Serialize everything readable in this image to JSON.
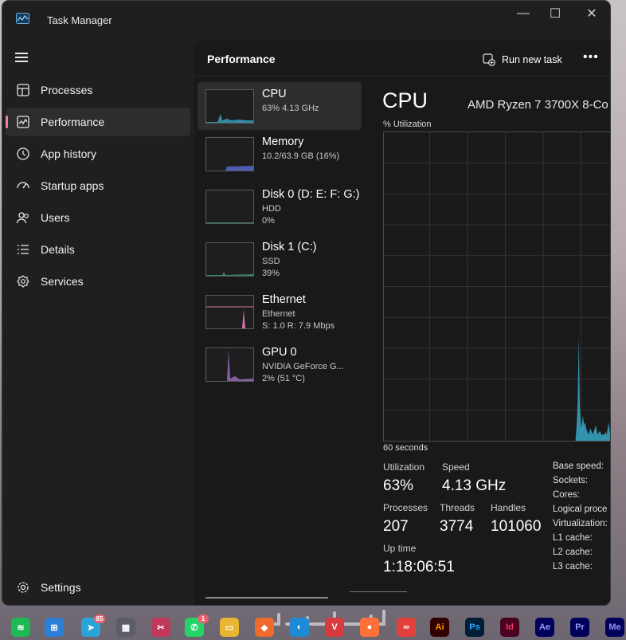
{
  "window": {
    "title": "Task Manager",
    "caption": {
      "minimize": "—",
      "maximize": "☐",
      "close": "✕"
    }
  },
  "sidebar": {
    "items": [
      {
        "label": "Processes",
        "icon": "processes-icon"
      },
      {
        "label": "Performance",
        "icon": "performance-icon",
        "active": true
      },
      {
        "label": "App history",
        "icon": "history-icon"
      },
      {
        "label": "Startup apps",
        "icon": "startup-icon"
      },
      {
        "label": "Users",
        "icon": "users-icon"
      },
      {
        "label": "Details",
        "icon": "details-icon"
      },
      {
        "label": "Services",
        "icon": "services-icon"
      }
    ],
    "settings_label": "Settings"
  },
  "header": {
    "title": "Performance",
    "run_task_label": "Run new task",
    "more_label": "•••"
  },
  "tiles": [
    {
      "name": "CPU",
      "line1": "63% 4.13 GHz",
      "line2": "",
      "color": "#37a8c9"
    },
    {
      "name": "Memory",
      "line1": "10.2/63.9 GB (16%)",
      "line2": "",
      "color": "#5a6bd6"
    },
    {
      "name": "Disk 0 (D: E: F: G:)",
      "line1": "HDD",
      "line2": "0%",
      "color": "#3f9d77"
    },
    {
      "name": "Disk 1 (C:)",
      "line1": "SSD",
      "line2": "39%",
      "color": "#3f9d77"
    },
    {
      "name": "Ethernet",
      "line1": "Ethernet",
      "line2": "S: 1.0 R: 7.9 Mbps",
      "color": "#d774a6"
    },
    {
      "name": "GPU 0",
      "line1": "NVIDIA GeForce G...",
      "line2": "2% (51 °C)",
      "color": "#9f6fc7"
    }
  ],
  "cpu": {
    "title": "CPU",
    "model": "AMD Ryzen 7 3700X 8-Co",
    "util_label": "% Utilization",
    "time_label": "60 seconds",
    "utilization_label": "Utilization",
    "utilization": "63%",
    "speed_label": "Speed",
    "speed": "4.13 GHz",
    "processes_label": "Processes",
    "processes": "207",
    "threads_label": "Threads",
    "threads": "3774",
    "handles_label": "Handles",
    "handles": "101060",
    "uptime_label": "Up time",
    "uptime": "1:18:06:51",
    "specs": [
      "Base speed:",
      "Sockets:",
      "Cores:",
      "Logical proce",
      "Virtualization:",
      "L1 cache:",
      "L2 cache:",
      "L3 cache:"
    ],
    "graph_color": "#37a8c9",
    "graph_values_pct": [
      0,
      0,
      0,
      0,
      0,
      0,
      0,
      0,
      0,
      0,
      0,
      0,
      0,
      0,
      0,
      0,
      0,
      0,
      0,
      0,
      0,
      0,
      0,
      0,
      0,
      0,
      0,
      0,
      0,
      0,
      0,
      0,
      0,
      0,
      0,
      0,
      0,
      0,
      0,
      0,
      0,
      0,
      0,
      0,
      0,
      0,
      0,
      0,
      0,
      0,
      0,
      0,
      0,
      0,
      0,
      0,
      0,
      0,
      0,
      0,
      0,
      0,
      0,
      0,
      0,
      0,
      0,
      0,
      0,
      0,
      0,
      0,
      0,
      0,
      0,
      0,
      0,
      0,
      0,
      0,
      0,
      0,
      0,
      0,
      0,
      0,
      0,
      0,
      0,
      0,
      0,
      0,
      0,
      0,
      0,
      0,
      0,
      0,
      0,
      0,
      0,
      0,
      0,
      0,
      0,
      0,
      0,
      0,
      0,
      0,
      0,
      0,
      0,
      0,
      0,
      0,
      0,
      0,
      0,
      0,
      0,
      0,
      0,
      0,
      0,
      0,
      0,
      0,
      0,
      0,
      0,
      0,
      0,
      0,
      0,
      0,
      0,
      0,
      0,
      0,
      0,
      0,
      0,
      0,
      0,
      0,
      0,
      0,
      0,
      0,
      0,
      0,
      0,
      0,
      0,
      0,
      0,
      0,
      0,
      0,
      0,
      0,
      0,
      0,
      0,
      0,
      0,
      0,
      0,
      0,
      0,
      0,
      0,
      0,
      0,
      0,
      0,
      0,
      0,
      0,
      5,
      12,
      34,
      12,
      4,
      6,
      8,
      5,
      6,
      4,
      3,
      2,
      3,
      4,
      3,
      2,
      3,
      4,
      5,
      3,
      2,
      3,
      3,
      2,
      2,
      2,
      2,
      3,
      2,
      4,
      6,
      3,
      2
    ]
  },
  "taskbar": {
    "icons": [
      {
        "name": "spotify-icon",
        "glyph": "≋",
        "color": "#1db954"
      },
      {
        "name": "store-icon",
        "glyph": "⊞",
        "color": "#2c7fd6"
      },
      {
        "name": "telegram-icon",
        "glyph": "➤",
        "color": "#2aa3d8",
        "badge": "85"
      },
      {
        "name": "calculator-icon",
        "glyph": "▦",
        "color": "#5d5d6a"
      },
      {
        "name": "snipping-tool-icon",
        "glyph": "✂",
        "color": "#c0395a"
      },
      {
        "name": "whatsapp-icon",
        "glyph": "✆",
        "color": "#25d366",
        "badge": "1"
      },
      {
        "name": "file-explorer-icon",
        "glyph": "▭",
        "color": "#e9b634"
      },
      {
        "name": "brave-icon",
        "glyph": "◆",
        "color": "#f06a2c"
      },
      {
        "name": "edge-icon",
        "glyph": "◐",
        "color": "#1e8ad6"
      },
      {
        "name": "vivaldi-icon",
        "glyph": "V",
        "color": "#d73b3e"
      },
      {
        "name": "firefox-icon",
        "glyph": "●",
        "color": "#ff7139"
      },
      {
        "name": "creative-cloud-icon",
        "glyph": "∞",
        "color": "#e2403a"
      },
      {
        "name": "illustrator-icon",
        "glyph": "Ai",
        "color": "#330000",
        "text_color": "#ff9a00"
      },
      {
        "name": "photoshop-icon",
        "glyph": "Ps",
        "color": "#001e36",
        "text_color": "#31a8ff"
      },
      {
        "name": "indesign-icon",
        "glyph": "Id",
        "color": "#49021f",
        "text_color": "#ff3366"
      },
      {
        "name": "after-effects-icon",
        "glyph": "Ae",
        "color": "#00005b",
        "text_color": "#9999ff"
      },
      {
        "name": "premiere-icon",
        "glyph": "Pr",
        "color": "#00005b",
        "text_color": "#9999ff"
      },
      {
        "name": "media-encoder-icon",
        "glyph": "Me",
        "color": "#00005b",
        "text_color": "#8f8fff"
      }
    ]
  }
}
